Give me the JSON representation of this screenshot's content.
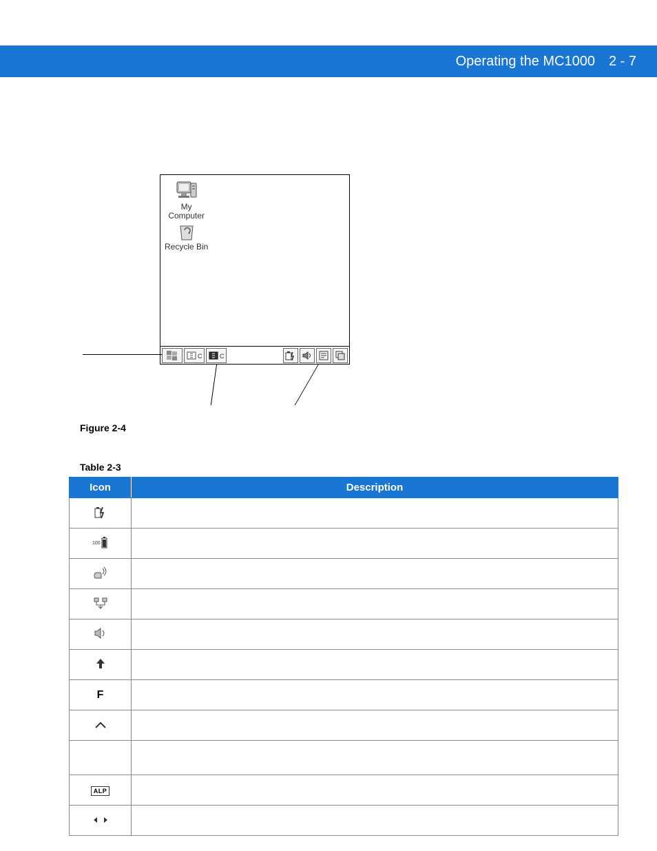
{
  "header": {
    "title": "Operating the MC1000",
    "page_number": "2 - 7"
  },
  "figure": {
    "label": "Figure 2-4",
    "desktop_icons": [
      {
        "name": "my-computer",
        "label_line1": "My",
        "label_line2": "Computer"
      },
      {
        "name": "recycle-bin",
        "label": "Recycle Bin"
      }
    ],
    "taskbar_left_icons": [
      "start-flag-icon",
      "keyboard-c-icon",
      "keyboard-dark-c-icon"
    ],
    "taskbar_right_icons": [
      "battery-bolt-icon",
      "speaker-icon",
      "note-icon",
      "windows-icon"
    ]
  },
  "table": {
    "label": "Table 2-3",
    "headers": {
      "icon": "Icon",
      "description": "Description"
    },
    "rows": [
      {
        "icon_name": "battery-bolt-icon",
        "description": ""
      },
      {
        "icon_name": "battery-100-icon",
        "description": ""
      },
      {
        "icon_name": "speaker-hand-icon",
        "description": ""
      },
      {
        "icon_name": "network-down-icon",
        "description": ""
      },
      {
        "icon_name": "speaker-icon",
        "description": ""
      },
      {
        "icon_name": "up-arrow-icon",
        "description": ""
      },
      {
        "icon_name": "f-key-icon",
        "icon_text": "F",
        "description": ""
      },
      {
        "icon_name": "caret-up-icon",
        "description": ""
      },
      {
        "icon_name": "blank-icon",
        "description": ""
      },
      {
        "icon_name": "alp-key-icon",
        "icon_text": "ALP",
        "description": ""
      },
      {
        "icon_name": "left-right-arrows-icon",
        "description": ""
      }
    ]
  }
}
